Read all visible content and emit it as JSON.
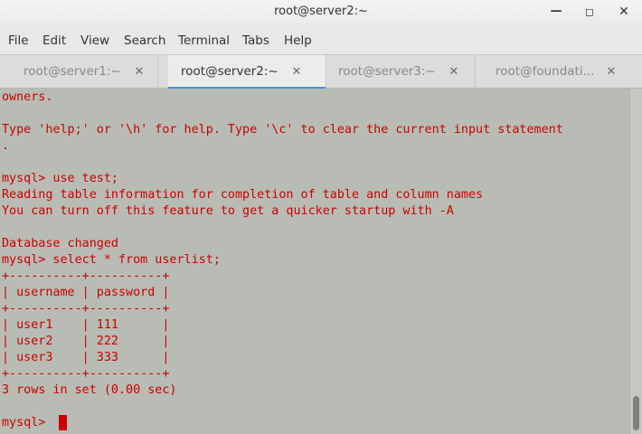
{
  "window": {
    "title": "root@server2:~",
    "min_glyph": "—",
    "max_glyph": "◻",
    "close_glyph": "✕"
  },
  "menu": [
    "File",
    "Edit",
    "View",
    "Search",
    "Terminal",
    "Tabs",
    "Help"
  ],
  "tabs": [
    {
      "label": "root@server1:~",
      "active": false
    },
    {
      "label": "root@server2:~",
      "active": true
    },
    {
      "label": "root@server3:~",
      "active": false
    },
    {
      "label": "root@foundati...",
      "active": false
    }
  ],
  "tab_close_glyph": "✕",
  "terminal": {
    "lines": [
      "owners.",
      "",
      "Type 'help;' or '\\h' for help. Type '\\c' to clear the current input statement",
      ".",
      "",
      "mysql> use test;",
      "Reading table information for completion of table and column names",
      "You can turn off this feature to get a quicker startup with -A",
      "",
      "Database changed",
      "mysql> select * from userlist;",
      "+----------+----------+",
      "| username | password |",
      "+----------+----------+",
      "| user1    | 111      |",
      "| user2    | 222      |",
      "| user3    | 333      |",
      "+----------+----------+",
      "3 rows in set (0.00 sec)",
      "",
      "mysql> "
    ],
    "text_color": "#cc0000",
    "background": "#b8bcb4"
  },
  "scrollbar": {
    "position_fraction": 0.95
  }
}
